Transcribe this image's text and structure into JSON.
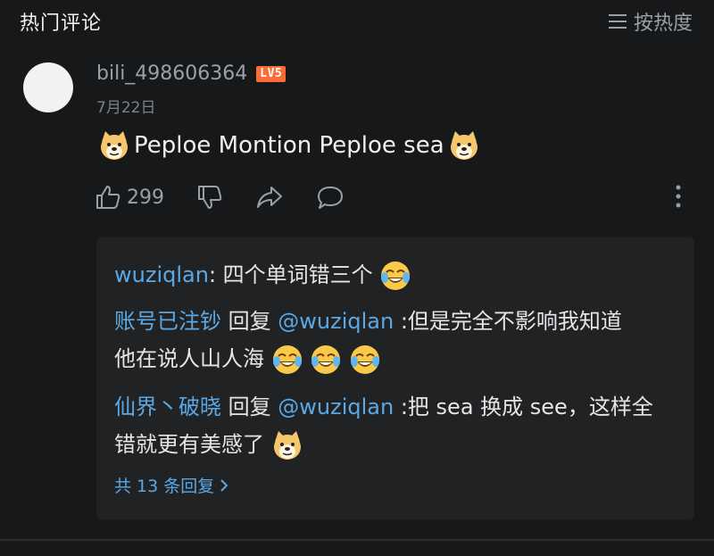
{
  "header": {
    "title": "热门评论",
    "sort_label": "按热度"
  },
  "comment": {
    "username": "bili_498606364",
    "level": "LV5",
    "date": "7月22日",
    "text": "Peploe Montion Peploe sea",
    "likes": "299"
  },
  "replies": [
    {
      "author": "wuziqlan",
      "sep": ": ",
      "text": "四个单词错三个"
    },
    {
      "author": "账号已注钞",
      "reply_word": " 回复 ",
      "mention": "@wuziqlan",
      "text1": " :但是完全不影响我知道",
      "text2": "他在说人山人海"
    },
    {
      "author": "仙界丶破晓",
      "reply_word": " 回复 ",
      "mention": "@wuziqlan",
      "text1": " :把 sea 换成 see，这样全",
      "text2": "错就更有美感了"
    }
  ],
  "more_replies": "共 13 条回复",
  "icons": {
    "sort": "menu-lines-icon",
    "like": "thumbs-up-icon",
    "dislike": "thumbs-down-icon",
    "share": "share-icon",
    "reply": "comment-bubble-icon",
    "more": "vertical-dots-icon",
    "emoji_doge": "doge-emoji",
    "emoji_cry": "laugh-cry-emoji"
  },
  "colors": {
    "link": "#5aa9e6",
    "level_badge": "#ff6b36",
    "background": "#17181a"
  }
}
